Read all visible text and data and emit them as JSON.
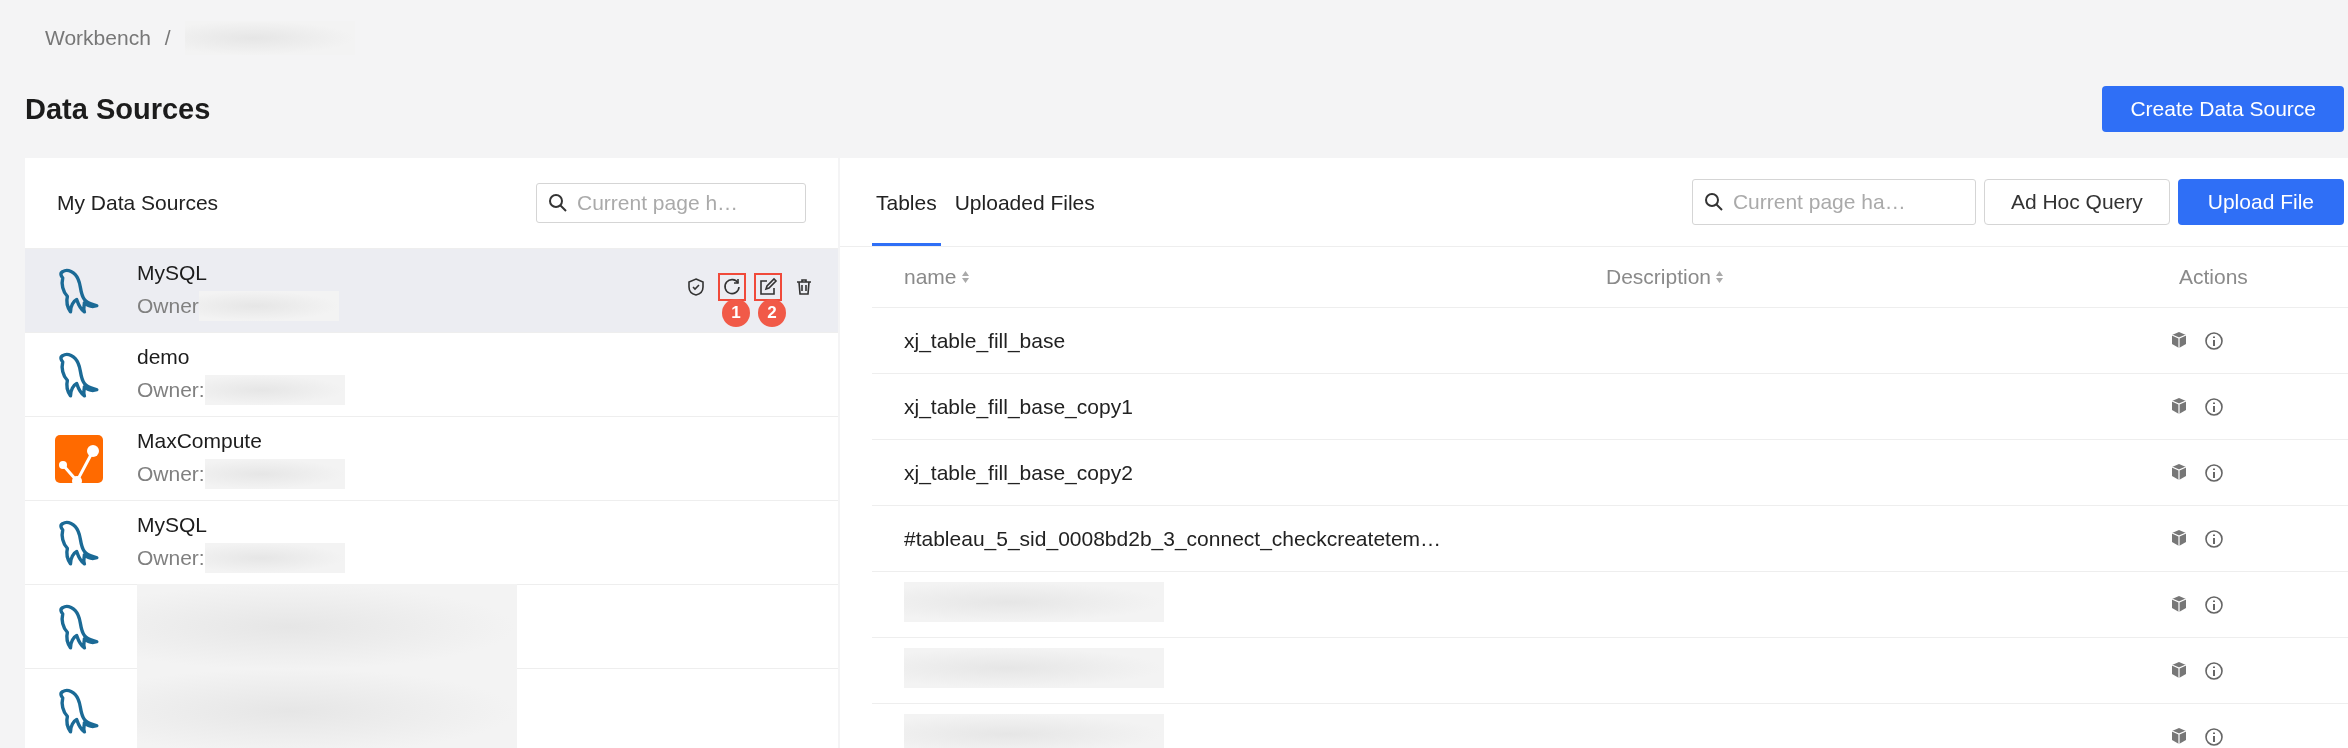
{
  "breadcrumb": {
    "items": [
      "Workbench"
    ],
    "separator": "/"
  },
  "page_title": "Data Sources",
  "create_button": "Create Data Source",
  "left_panel": {
    "title": "My Data Sources",
    "search": {
      "placeholder": "Current page h…"
    },
    "items": [
      {
        "kind": "mysql",
        "name": "MySQL",
        "owner": "Owner",
        "selected": true,
        "actions": true
      },
      {
        "kind": "mysql",
        "name": "demo",
        "owner": "Owner:",
        "selected": false,
        "actions": false
      },
      {
        "kind": "maxcompute",
        "name": "MaxCompute",
        "owner": "Owner:",
        "selected": false,
        "actions": false
      },
      {
        "kind": "mysql",
        "name": "MySQL",
        "owner": "Owner:",
        "selected": false,
        "actions": false
      },
      {
        "kind": "mysql",
        "selected": false,
        "actions": false
      },
      {
        "kind": "mysql",
        "selected": false,
        "actions": false
      }
    ],
    "annotations": [
      "1",
      "2"
    ]
  },
  "right_panel": {
    "tabs": [
      {
        "label": "Tables",
        "selected": true
      },
      {
        "label": "Uploaded Files",
        "selected": false
      }
    ],
    "search": {
      "placeholder": "Current page ha…"
    },
    "buttons": [
      {
        "label": "Ad Hoc Query",
        "kind": "default"
      },
      {
        "label": "Upload File",
        "kind": "primary"
      }
    ],
    "table": {
      "columns": [
        {
          "label": "name",
          "sortable": true
        },
        {
          "label": "Description",
          "sortable": true
        },
        {
          "label": "Actions",
          "sortable": false
        }
      ],
      "rows": [
        {
          "name": "xj_table_fill_base",
          "redacted": false
        },
        {
          "name": "xj_table_fill_base_copy1",
          "redacted": false
        },
        {
          "name": "xj_table_fill_base_copy2",
          "redacted": false
        },
        {
          "name": "#tableau_5_sid_0008bd2b_3_connect_checkcreatetem…",
          "redacted": false
        },
        {
          "redacted": true
        },
        {
          "redacted": true
        },
        {
          "redacted": true
        }
      ]
    }
  }
}
